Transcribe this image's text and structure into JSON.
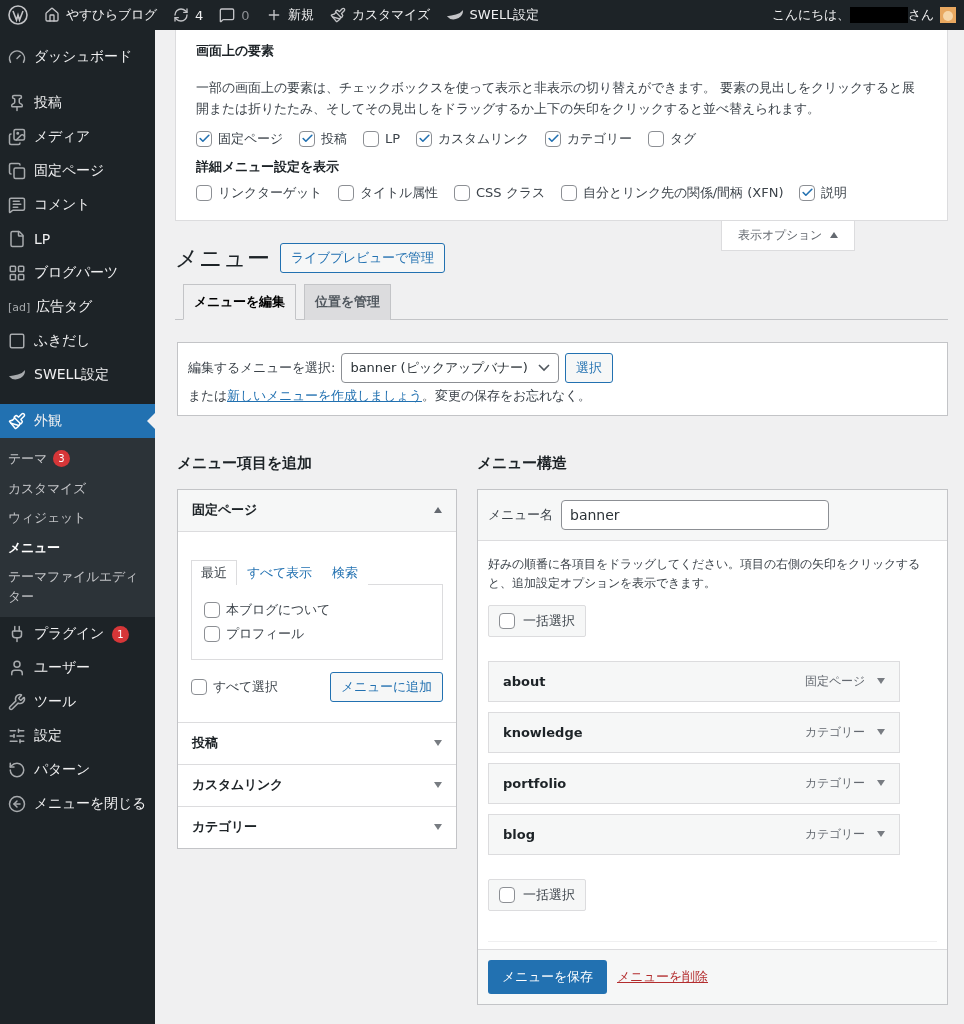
{
  "admin_bar": {
    "items": [
      {
        "kind": "home",
        "label": "やすひらブログ"
      },
      {
        "kind": "updates",
        "label": "4"
      },
      {
        "kind": "comments",
        "label": "0"
      },
      {
        "kind": "new",
        "label": "新規"
      },
      {
        "kind": "customize",
        "label": "カスタマイズ"
      },
      {
        "kind": "swell",
        "label": "SWELL設定"
      }
    ],
    "greeting_before": "こんにちは、",
    "greeting_after": "さん"
  },
  "sidebar": {
    "items": [
      {
        "label": "ダッシュボード",
        "selected": false
      },
      {
        "label": "投稿",
        "selected": false
      },
      {
        "label": "メディア",
        "selected": false
      },
      {
        "label": "固定ページ",
        "selected": false
      },
      {
        "label": "コメント",
        "selected": false
      },
      {
        "label": "LP",
        "selected": false
      },
      {
        "label": "ブログパーツ",
        "selected": false
      },
      {
        "label": "広告タグ",
        "icon_text": "[ad]",
        "selected": false
      },
      {
        "label": "ふきだし",
        "selected": false
      },
      {
        "label": "SWELL設定",
        "selected": false
      },
      {
        "label": "外観",
        "selected": true,
        "children": [
          {
            "label": "テーマ",
            "badge": "3",
            "selected": false
          },
          {
            "label": "カスタマイズ",
            "selected": false
          },
          {
            "label": "ウィジェット",
            "selected": false
          },
          {
            "label": "メニュー",
            "selected": true
          },
          {
            "label": "テーマファイルエディター",
            "selected": false
          }
        ]
      },
      {
        "label": "プラグイン",
        "badge": "1",
        "selected": false
      },
      {
        "label": "ユーザー",
        "selected": false
      },
      {
        "label": "ツール",
        "selected": false
      },
      {
        "label": "設定",
        "selected": false
      },
      {
        "label": "パターン",
        "selected": false
      },
      {
        "label": "メニューを閉じる",
        "selected": false
      }
    ]
  },
  "screen_options": {
    "heading": "画面上の要素",
    "description": "一部の画面上の要素は、チェックボックスを使って表示と非表示の切り替えができます。 要素の見出しをクリックすると展開または折りたたみ、そしてその見出しをドラッグするか上下の矢印をクリックすると並べ替えられます。",
    "boxes": [
      {
        "label": "固定ページ",
        "checked": true
      },
      {
        "label": "投稿",
        "checked": true
      },
      {
        "label": "LP",
        "checked": false
      },
      {
        "label": "カスタムリンク",
        "checked": true
      },
      {
        "label": "カテゴリー",
        "checked": true
      },
      {
        "label": "タグ",
        "checked": false
      }
    ],
    "advanced_heading": "詳細メニュー設定を表示",
    "advanced": [
      {
        "label": "リンクターゲット",
        "checked": false
      },
      {
        "label": "タイトル属性",
        "checked": false
      },
      {
        "label": "CSS クラス",
        "checked": false
      },
      {
        "label": "自分とリンク先の関係/間柄 (XFN)",
        "checked": false
      },
      {
        "label": "説明",
        "checked": true
      }
    ],
    "toggle": "表示オプション",
    "expanded": true
  },
  "page": {
    "title": "メニュー",
    "preview_button": "ライブプレビューで管理",
    "tabs": [
      {
        "label": "メニューを編集",
        "selected": true
      },
      {
        "label": "位置を管理",
        "selected": false
      }
    ],
    "select_bar": {
      "label": "編集するメニューを選択:",
      "value": "banner (ピックアップバナー)",
      "button": "選択",
      "note_before": "または",
      "note_link": "新しいメニューを作成しましょう",
      "note_after": "。変更の保存をお忘れなく。"
    }
  },
  "add_items": {
    "title": "メニュー項目を追加",
    "panels": [
      {
        "title": "固定ページ",
        "expanded": true,
        "tabs": [
          {
            "label": "最近",
            "selected": true
          },
          {
            "label": "すべて表示",
            "selected": false
          },
          {
            "label": "検索",
            "selected": false
          }
        ],
        "items": [
          {
            "label": "本ブログについて",
            "checked": false
          },
          {
            "label": "プロフィール",
            "checked": false
          }
        ],
        "select_all": {
          "label": "すべて選択",
          "checked": false
        },
        "button": "メニューに追加"
      },
      {
        "title": "投稿",
        "expanded": false
      },
      {
        "title": "カスタムリンク",
        "expanded": false
      },
      {
        "title": "カテゴリー",
        "expanded": false
      }
    ]
  },
  "structure": {
    "title": "メニュー構造",
    "name_label": "メニュー名",
    "name_value": "banner",
    "instructions": "好みの順番に各項目をドラッグしてください。項目の右側の矢印をクリックすると、追加設定オプションを表示できます。",
    "bulk_top": {
      "label": "一括選択",
      "checked": false
    },
    "items": [
      {
        "title": "about",
        "type": "固定ページ"
      },
      {
        "title": "knowledge",
        "type": "カテゴリー"
      },
      {
        "title": "portfolio",
        "type": "カテゴリー"
      },
      {
        "title": "blog",
        "type": "カテゴリー"
      }
    ],
    "bulk_bottom": {
      "label": "一括選択",
      "checked": false
    },
    "save_button": "メニューを保存",
    "delete_link": "メニューを削除"
  }
}
